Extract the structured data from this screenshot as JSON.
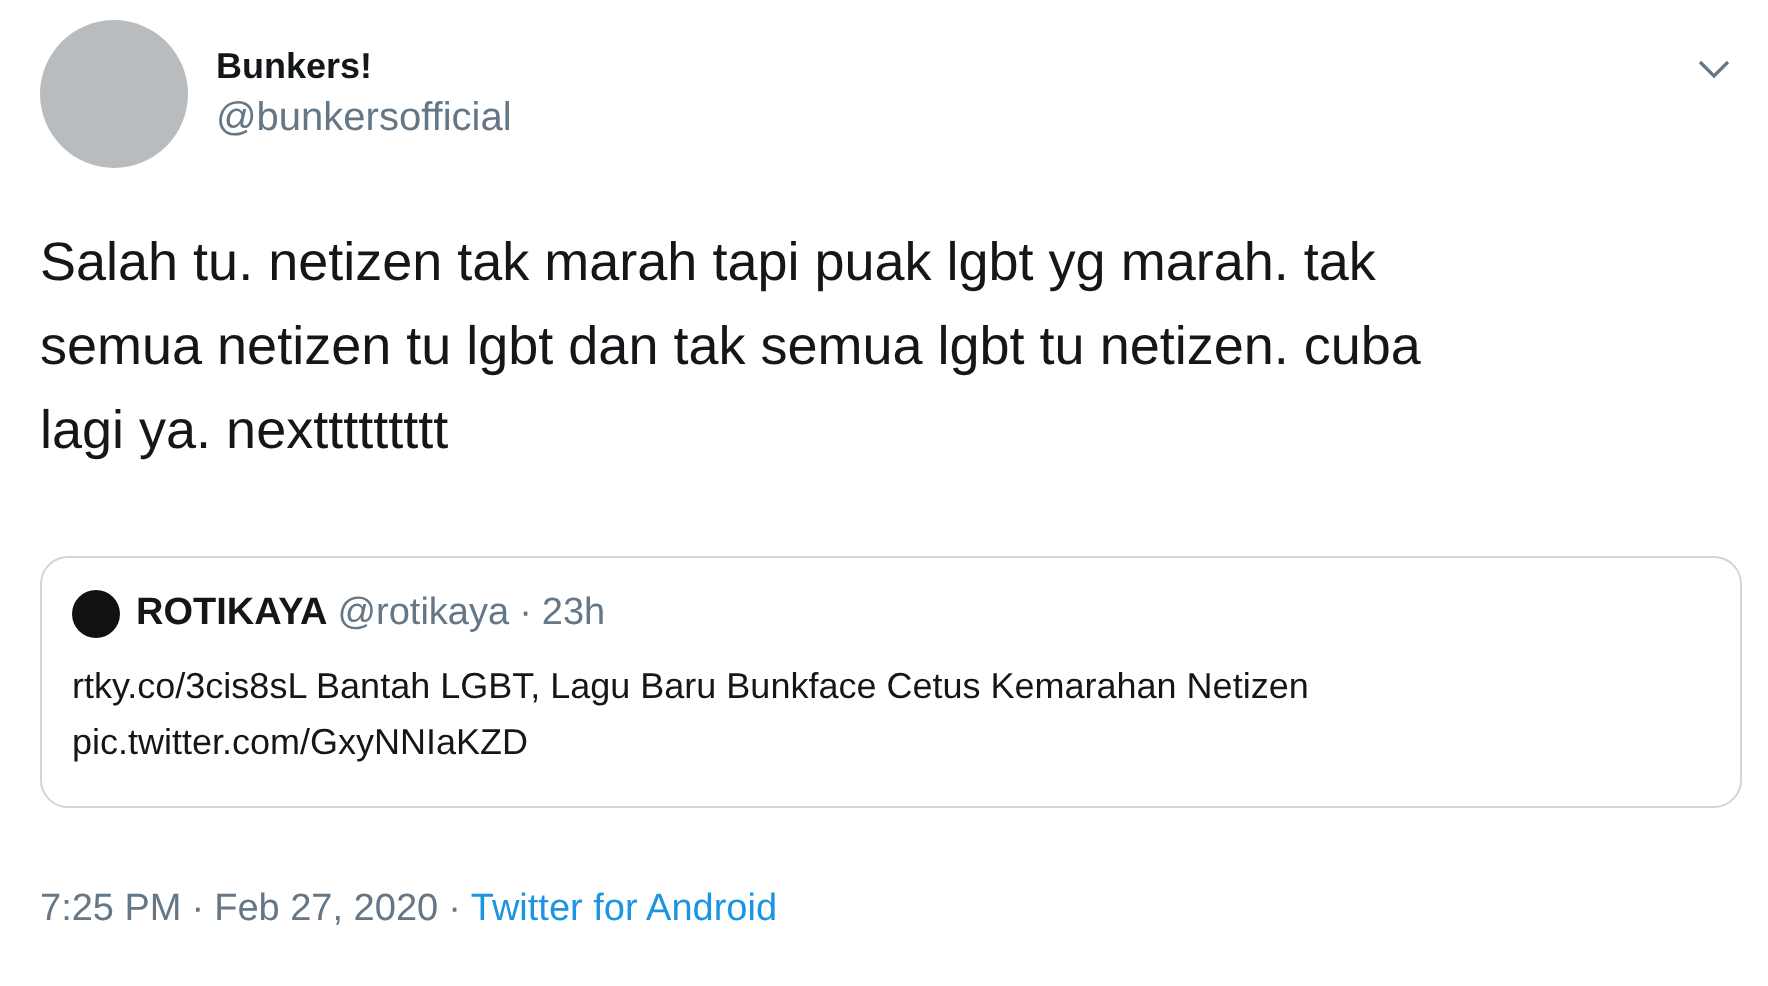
{
  "author": {
    "name": "Bunkers!",
    "handle": "@bunkersofficial"
  },
  "tweet_text": "Salah tu. netizen tak marah tapi puak lgbt yg marah. tak semua netizen tu lgbt dan tak semua lgbt tu netizen. cuba lagi ya. nexttttttttt",
  "quoted_tweet": {
    "name": "ROTIKAYA",
    "handle": "@rotikaya",
    "separator": "·",
    "time": "23h",
    "lines": [
      "rtky.co/3cis8sL Bantah LGBT, Lagu Baru Bunkface Cetus Kemarahan Netizen",
      "pic.twitter.com/GxyNNIaKZD"
    ]
  },
  "footer": {
    "time": "7:25 PM",
    "separator_1": "·",
    "date": "Feb 27, 2020",
    "separator_2": "·",
    "source": "Twitter for Android"
  }
}
